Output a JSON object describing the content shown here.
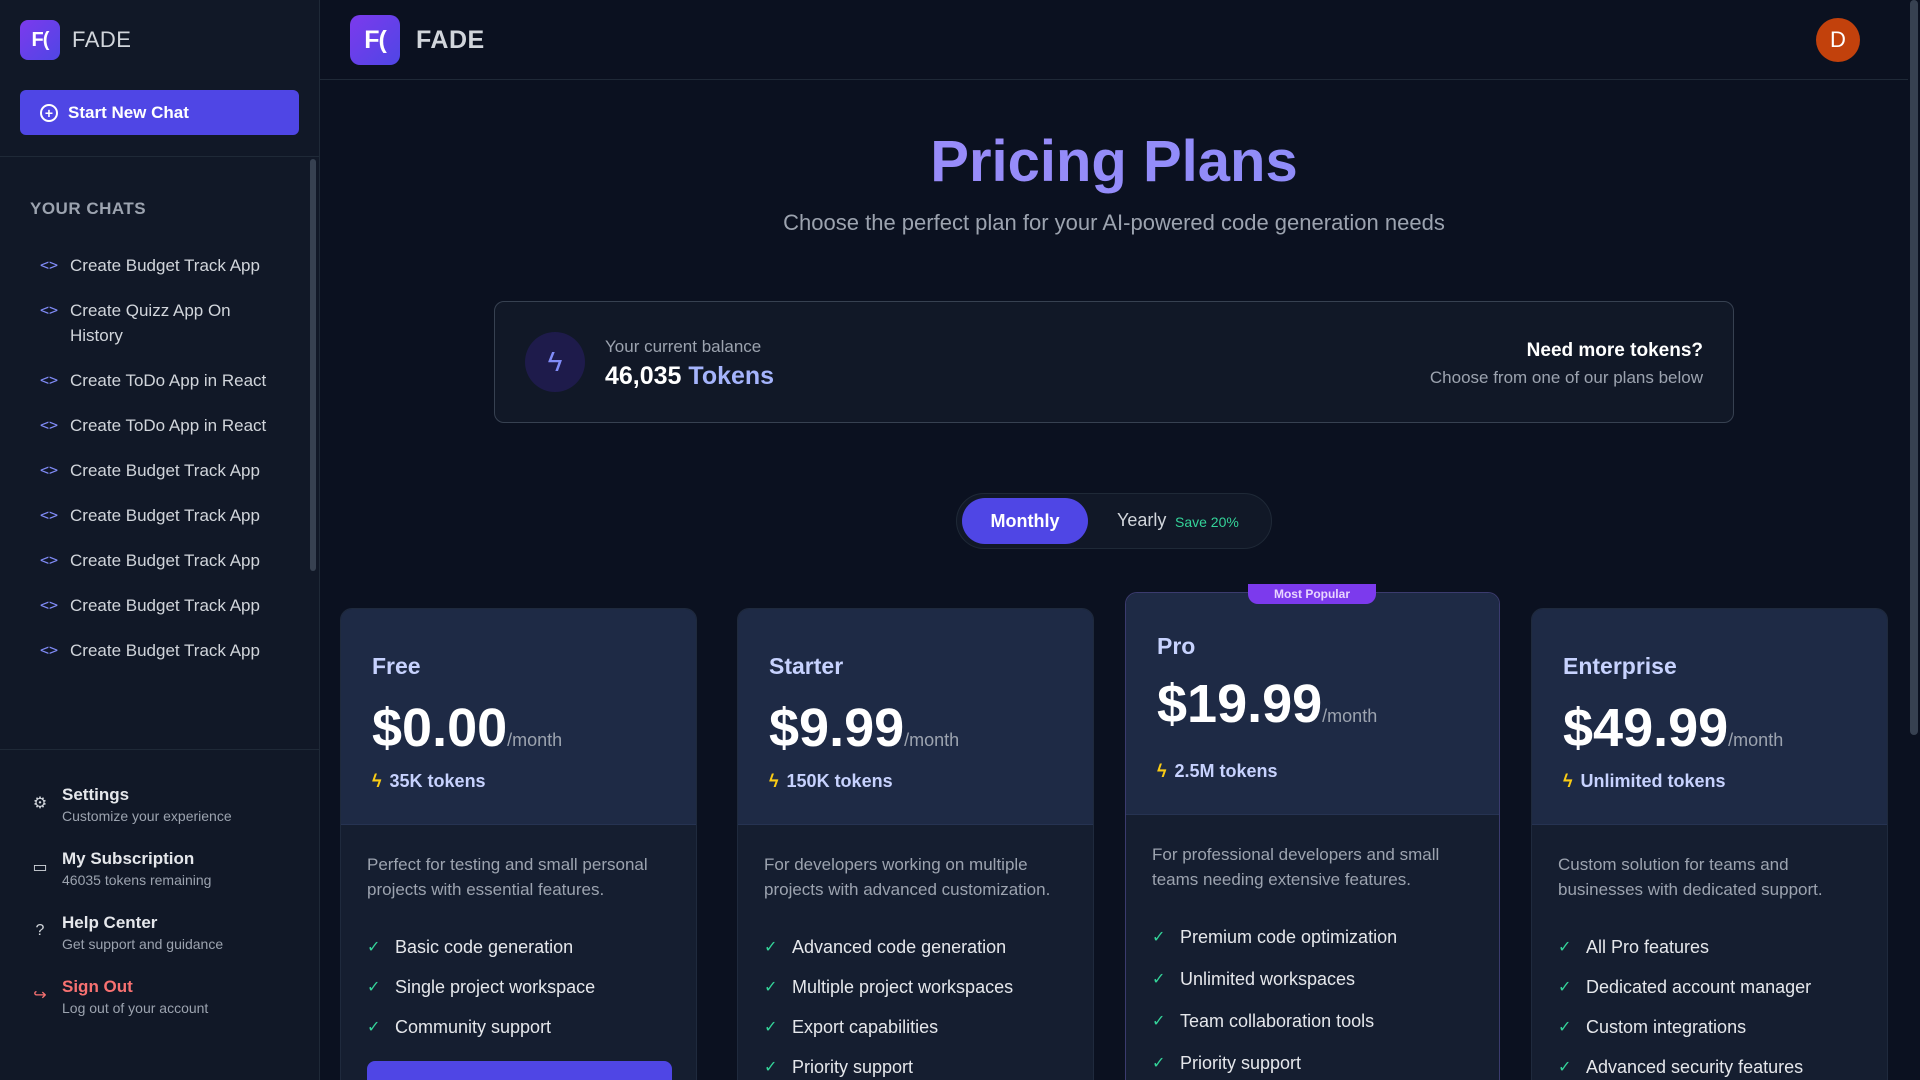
{
  "brand": {
    "name": "FADE",
    "logo_text": "F("
  },
  "sidebar": {
    "new_chat_label": "Start New Chat",
    "section_title": "YOUR CHATS",
    "chats": [
      "Create Budget Track App",
      "Create Quizz App On History",
      "Create ToDo App in React",
      "Create ToDo App in React",
      "Create Budget Track App",
      "Create Budget Track App",
      "Create Budget Track App",
      "Create Budget Track App",
      "Create Budget Track App"
    ],
    "links": {
      "settings": {
        "title": "Settings",
        "subtitle": "Customize your experience",
        "icon": "gear-icon"
      },
      "subscription": {
        "title": "My Subscription",
        "subtitle": "46035 tokens remaining",
        "icon": "wallet-icon"
      },
      "help": {
        "title": "Help Center",
        "subtitle": "Get support and guidance",
        "icon": "question-icon"
      },
      "signout": {
        "title": "Sign Out",
        "subtitle": "Log out of your account",
        "icon": "logout-icon"
      }
    }
  },
  "topbar": {
    "avatar_initial": "D"
  },
  "hero": {
    "title": "Pricing Plans",
    "subtitle": "Choose the perfect plan for your AI-powered code generation needs"
  },
  "balance": {
    "label": "Your current balance",
    "amount": "46,035",
    "unit": "Tokens",
    "cta_title": "Need more tokens?",
    "cta_subtitle": "Choose from one of our plans below"
  },
  "billing_toggle": {
    "monthly": "Monthly",
    "yearly": "Yearly",
    "save": "Save 20%",
    "selected": "Monthly"
  },
  "plans": [
    {
      "name": "Free",
      "price": "$0.00",
      "period": "/month",
      "tokens": "35K tokens",
      "description": "Perfect for testing and small personal projects with essential features.",
      "features": [
        "Basic code generation",
        "Single project workspace",
        "Community support"
      ]
    },
    {
      "name": "Starter",
      "price": "$9.99",
      "period": "/month",
      "tokens": "150K tokens",
      "description": "For developers working on multiple projects with advanced customization.",
      "features": [
        "Advanced code generation",
        "Multiple project workspaces",
        "Export capabilities",
        "Priority support"
      ]
    },
    {
      "name": "Pro",
      "price": "$19.99",
      "period": "/month",
      "tokens": "2.5M tokens",
      "badge": "Most Popular",
      "description": "For professional developers and small teams needing extensive features.",
      "features": [
        "Premium code optimization",
        "Unlimited workspaces",
        "Team collaboration tools",
        "Priority support"
      ]
    },
    {
      "name": "Enterprise",
      "price": "$49.99",
      "period": "/month",
      "tokens": "Unlimited tokens",
      "description": "Custom solution for teams and businesses with dedicated support.",
      "features": [
        "All Pro features",
        "Dedicated account manager",
        "Custom integrations",
        "Advanced security features"
      ]
    }
  ],
  "colors": {
    "accent": "#4f46e5",
    "title_gradient_start": "#a78bfa",
    "check": "#34d399",
    "danger": "#f87171",
    "bolt": "#facc15"
  }
}
